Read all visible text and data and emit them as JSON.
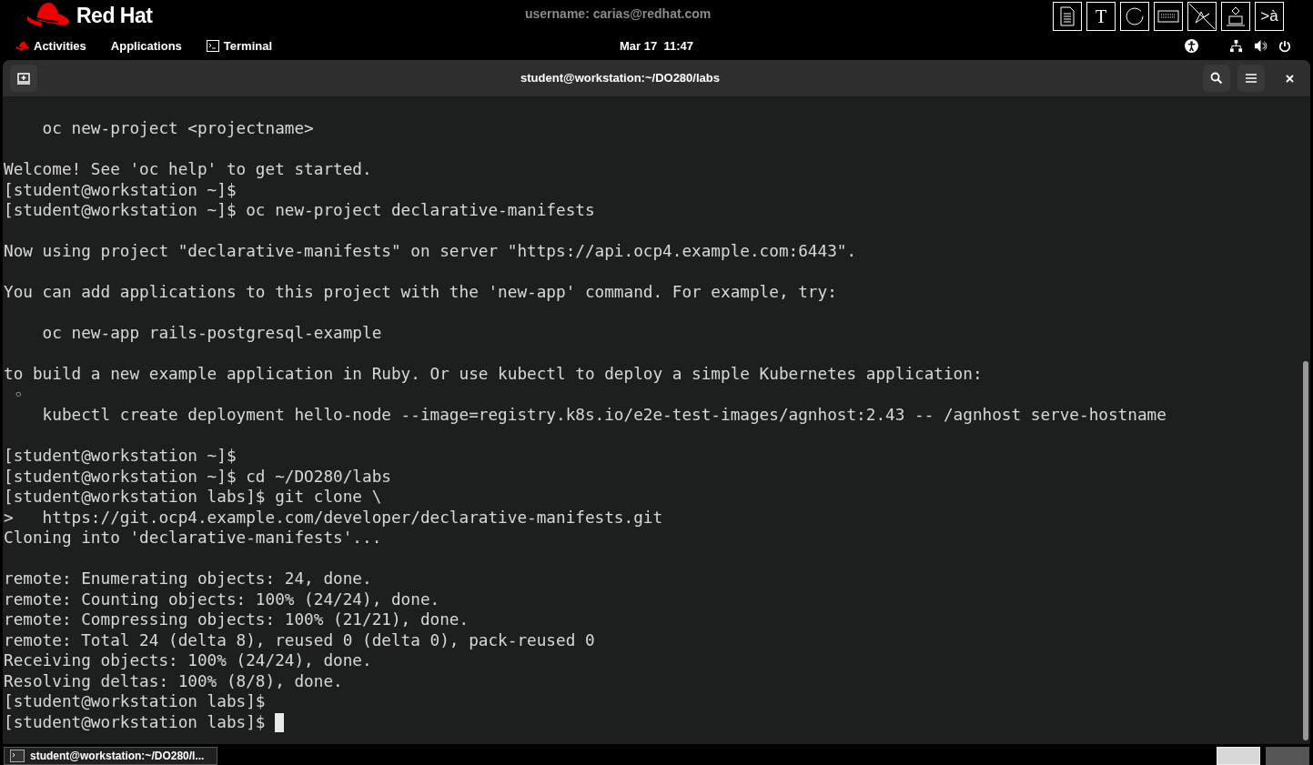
{
  "top_panel": {
    "brand": "Red Hat",
    "username": "username: carias@redhat.com",
    "tool_buttons": [
      {
        "kind": "icon"
      },
      {
        "kind": "glyph",
        "label": "T"
      },
      {
        "kind": "icon"
      },
      {
        "kind": "icon"
      },
      {
        "kind": "icon"
      },
      {
        "kind": "icon"
      },
      {
        "kind": "glyph",
        "label": ">à"
      }
    ],
    "menu": [
      "Activities",
      "Applications",
      "Terminal"
    ],
    "clock": "Mar 17  11:47"
  },
  "window": {
    "title": "student@workstation:~/DO280/labs",
    "lines": [
      {
        "text": "    oc new-project <projectname>",
        "gap_before": false,
        "cursor": false
      },
      {
        "text": "Welcome! See 'oc help' to get started.",
        "gap_before": true,
        "cursor": false
      },
      {
        "text": "[student@workstation ~]$",
        "gap_before": false,
        "cursor": false
      },
      {
        "text": "[student@workstation ~]$ oc new-project declarative-manifests",
        "gap_before": false,
        "cursor": false
      },
      {
        "text": "Now using project \"declarative-manifests\" on server \"https://api.ocp4.example.com:6443\".",
        "gap_before": true,
        "cursor": false
      },
      {
        "text": "You can add applications to this project with the 'new-app' command. For example, try:",
        "gap_before": true,
        "cursor": false
      },
      {
        "text": "    oc new-app rails-postgresql-example",
        "gap_before": true,
        "cursor": false
      },
      {
        "text": "to build a new example application in Ruby. Or use kubectl to deploy a simple Kubernetes application:",
        "gap_before": true,
        "cursor": false
      },
      {
        "text": " ◦",
        "gap_before": false,
        "cursor": false
      },
      {
        "text": "    kubectl create deployment hello-node --image=registry.k8s.io/e2e-test-images/agnhost:2.43 -- /agnhost serve-hostname",
        "gap_before": false,
        "cursor": false
      },
      {
        "text": "[student@workstation ~]$",
        "gap_before": true,
        "cursor": false
      },
      {
        "text": "[student@workstation ~]$ cd ~/DO280/labs",
        "gap_before": false,
        "cursor": false
      },
      {
        "text": "[student@workstation labs]$ git clone \\",
        "gap_before": false,
        "cursor": false
      },
      {
        "text": ">   https://git.ocp4.example.com/developer/declarative-manifests.git",
        "gap_before": false,
        "cursor": false
      },
      {
        "text": "Cloning into 'declarative-manifests'...",
        "gap_before": false,
        "cursor": false
      },
      {
        "text": "remote: Enumerating objects: 24, done.",
        "gap_before": true,
        "cursor": false
      },
      {
        "text": "remote: Counting objects: 100% (24/24), done.",
        "gap_before": false,
        "cursor": false
      },
      {
        "text": "remote: Compressing objects: 100% (21/21), done.",
        "gap_before": false,
        "cursor": false
      },
      {
        "text": "remote: Total 24 (delta 8), reused 0 (delta 0), pack-reused 0",
        "gap_before": false,
        "cursor": false
      },
      {
        "text": "Receiving objects: 100% (24/24), done.",
        "gap_before": false,
        "cursor": false
      },
      {
        "text": "Resolving deltas: 100% (8/8), done.",
        "gap_before": false,
        "cursor": false
      },
      {
        "text": "[student@workstation labs]$",
        "gap_before": false,
        "cursor": false
      },
      {
        "text": "[student@workstation labs]$ ",
        "gap_before": false,
        "cursor": true
      }
    ]
  },
  "taskbar": {
    "item": "student@workstation:~/DO280/l...",
    "workspaces": [
      {
        "selected": true
      },
      {
        "selected": false
      }
    ]
  }
}
